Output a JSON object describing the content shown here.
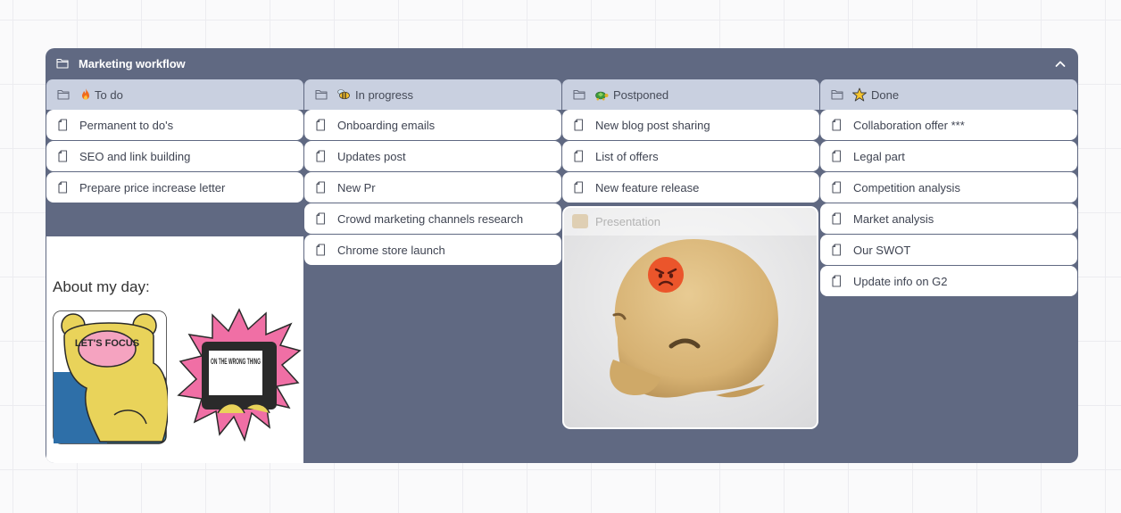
{
  "board": {
    "title": "Marketing workflow",
    "colors": {
      "frame": "#606982",
      "column_header": "#c9d0e0",
      "card": "#ffffff"
    },
    "icons": {
      "folder": "folder-icon",
      "collapse": "chevron-up-icon",
      "card": "document-icon"
    }
  },
  "columns": [
    {
      "title": "To do",
      "emoji": "fire",
      "cards": [
        "Permanent to do's",
        "SEO and link building",
        "Prepare price increase letter"
      ],
      "note": {
        "title": "About my day:",
        "stickers": [
          {
            "text": "LET'S FOCUS"
          },
          {
            "text": "ON THE WRONG THING"
          }
        ]
      }
    },
    {
      "title": "In progress",
      "emoji": "bee",
      "cards": [
        "Onboarding emails",
        "Updates post",
        "New Pr",
        "Crowd marketing channels research",
        "Chrome store launch"
      ]
    },
    {
      "title": "Postponed",
      "emoji": "turtle",
      "cards": [
        "New blog post sharing",
        "List of offers",
        "New feature release"
      ],
      "media_card": {
        "label": "Presentation",
        "emoji": "angry-face"
      }
    },
    {
      "title": "Done",
      "emoji": "star",
      "cards": [
        "Collaboration offer ***",
        "Legal part",
        "Competition analysis",
        "Market analysis",
        "Our SWOT",
        "Update info on G2"
      ]
    }
  ]
}
